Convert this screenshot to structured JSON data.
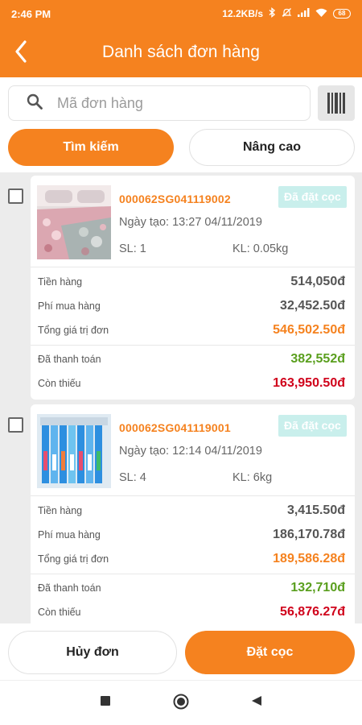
{
  "status_bar": {
    "time": "2:46 PM",
    "network_speed": "12.2KB/s",
    "battery": "68"
  },
  "header": {
    "title": "Danh sách đơn hàng"
  },
  "search": {
    "placeholder": "Mã đơn hàng",
    "value": ""
  },
  "buttons": {
    "search": "Tìm kiếm",
    "advanced": "Nâng cao",
    "cancel": "Hủy đơn",
    "deposit": "Đặt cọc"
  },
  "labels": {
    "goods": "Tiền hàng",
    "fee": "Phí mua hàng",
    "total": "Tổng giá trị đơn",
    "paid": "Đã thanh toán",
    "remaining": "Còn thiếu"
  },
  "colors": {
    "accent": "#f5821f",
    "badge_bg": "#c9efec",
    "paid": "#5a9f1e",
    "remaining": "#d0021b"
  },
  "orders": [
    {
      "code": "000062SG041119002",
      "status": "Đã đặt cọc",
      "created": "Ngày tạo: 13:27 04/11/2019",
      "qty": "SL: 1",
      "weight": "KL: 0.05kg",
      "goods": "514,050đ",
      "fee": "32,452.50đ",
      "total": "546,502.50đ",
      "paid": "382,552đ",
      "remaining": "163,950.50đ",
      "thumbnail": "bedding-photo"
    },
    {
      "code": "000062SG041119001",
      "status": "Đã đặt cọc",
      "created": "Ngày tạo: 12:14 04/11/2019",
      "qty": "SL: 4",
      "weight": "KL: 6kg",
      "goods": "3,415.50đ",
      "fee": "186,170.78đ",
      "total": "189,586.28đ",
      "paid": "132,710đ",
      "remaining": "56,876.27đ",
      "thumbnail": "toothbrush-photo"
    }
  ],
  "icons": {
    "back": "back-arrow-icon",
    "search": "search-icon",
    "barcode": "barcode-icon",
    "square": "square-nav-icon",
    "home": "circle-nav-icon",
    "triangle": "triangle-nav-icon"
  }
}
